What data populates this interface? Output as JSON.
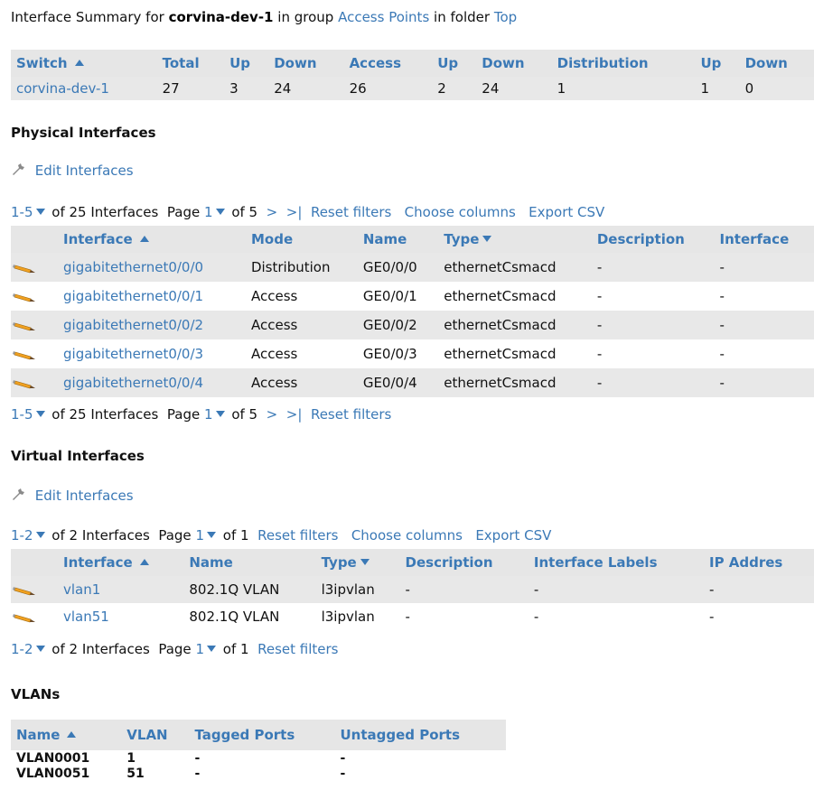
{
  "header": {
    "prefix": "Interface Summary for",
    "switch_name": "corvina-dev-1",
    "in_group": "in group",
    "group": "Access Points",
    "in_folder": "in folder",
    "folder": "Top"
  },
  "summary": {
    "columns": [
      "Switch",
      "Total",
      "Up",
      "Down",
      "Access",
      "Up",
      "Down",
      "Distribution",
      "Up",
      "Down"
    ],
    "row": [
      "corvina-dev-1",
      "27",
      "3",
      "24",
      "26",
      "2",
      "24",
      "1",
      "1",
      "0"
    ]
  },
  "physical": {
    "title": "Physical Interfaces",
    "edit_label": "Edit Interfaces",
    "pager_top": {
      "range": "1-5",
      "of_total": "of 25 Interfaces",
      "page_label": "Page",
      "page": "1",
      "of_pages": "of 5",
      "next": ">",
      "last": ">|",
      "reset": "Reset filters",
      "choose": "Choose columns",
      "export": "Export CSV"
    },
    "pager_bottom": {
      "range": "1-5",
      "of_total": "of 25 Interfaces",
      "page_label": "Page",
      "page": "1",
      "of_pages": "of 5",
      "next": ">",
      "last": ">|",
      "reset": "Reset filters"
    },
    "columns": [
      "Interface",
      "Mode",
      "Name",
      "Type",
      "Description",
      "Interface"
    ],
    "rows": [
      [
        "gigabitethernet0/0/0",
        "Distribution",
        "GE0/0/0",
        "ethernetCsmacd",
        "-",
        "-"
      ],
      [
        "gigabitethernet0/0/1",
        "Access",
        "GE0/0/1",
        "ethernetCsmacd",
        "-",
        "-"
      ],
      [
        "gigabitethernet0/0/2",
        "Access",
        "GE0/0/2",
        "ethernetCsmacd",
        "-",
        "-"
      ],
      [
        "gigabitethernet0/0/3",
        "Access",
        "GE0/0/3",
        "ethernetCsmacd",
        "-",
        "-"
      ],
      [
        "gigabitethernet0/0/4",
        "Access",
        "GE0/0/4",
        "ethernetCsmacd",
        "-",
        "-"
      ]
    ]
  },
  "virtual": {
    "title": "Virtual Interfaces",
    "edit_label": "Edit Interfaces",
    "pager_top": {
      "range": "1-2",
      "of_total": "of 2 Interfaces",
      "page_label": "Page",
      "page": "1",
      "of_pages": "of 1",
      "reset": "Reset filters",
      "choose": "Choose columns",
      "export": "Export CSV"
    },
    "pager_bottom": {
      "range": "1-2",
      "of_total": "of 2 Interfaces",
      "page_label": "Page",
      "page": "1",
      "of_pages": "of 1",
      "reset": "Reset filters"
    },
    "columns": [
      "Interface",
      "Name",
      "Type",
      "Description",
      "Interface Labels",
      "IP Addres"
    ],
    "rows": [
      [
        "vlan1",
        "802.1Q VLAN",
        "l3ipvlan",
        "-",
        "-",
        "-"
      ],
      [
        "vlan51",
        "802.1Q VLAN",
        "l3ipvlan",
        "-",
        "-",
        "-"
      ]
    ]
  },
  "vlans": {
    "title": "VLANs",
    "columns": [
      "Name",
      "VLAN",
      "Tagged Ports",
      "Untagged Ports"
    ],
    "rows": [
      [
        "VLAN0001",
        "1",
        "-",
        "-"
      ],
      [
        "VLAN0051",
        "51",
        "-",
        "-"
      ]
    ]
  },
  "colors": {
    "link": "#3b79b6",
    "header_bg": "#e6e6e6",
    "row_shade": "#e8e8e8",
    "pencil": "#f0a020"
  },
  "icons": {
    "edit": "wrench-icon",
    "row_edit": "pencil-icon",
    "sort_asc": "sort-ascending-icon",
    "sort_desc": "sort-descending-icon",
    "dropdown": "chevron-down-icon"
  }
}
